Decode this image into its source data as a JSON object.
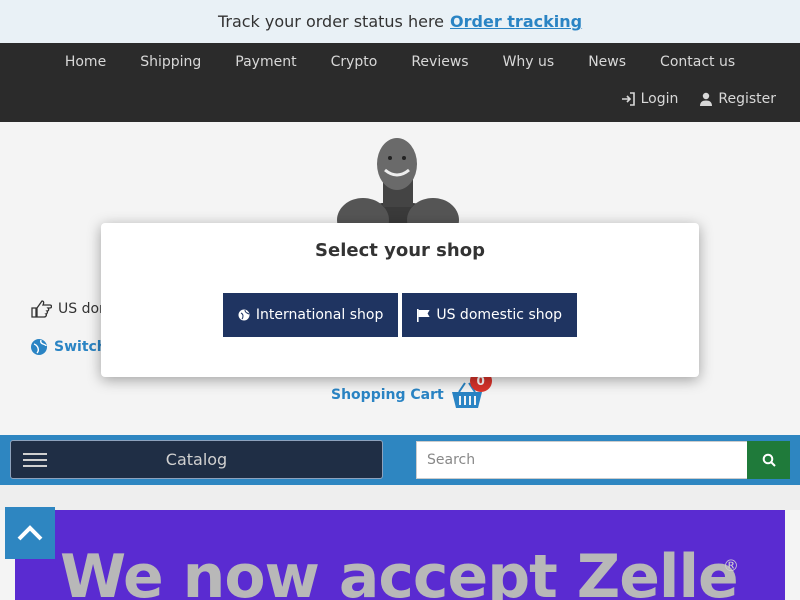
{
  "topbar": {
    "text": "Track your order status here",
    "link": "Order tracking"
  },
  "nav": {
    "items": [
      "Home",
      "Shipping",
      "Payment",
      "Crypto",
      "Reviews",
      "Why us",
      "News",
      "Contact us"
    ],
    "login": "Login",
    "register": "Register"
  },
  "main": {
    "us_domestic_label": "US dom",
    "switch_label": "Switch",
    "cart_label": "Shopping Cart",
    "cart_count": "0"
  },
  "catalog": {
    "label": "Catalog",
    "search_placeholder": "Search"
  },
  "banner": {
    "text": "We now accept Zelle",
    "mark": "®"
  },
  "modal": {
    "title": "Select your shop",
    "intl_button": "International shop",
    "us_button": "US domestic shop"
  },
  "colors": {
    "accent": "#2e86c1",
    "navy": "#1f3461",
    "nav_bg": "#2b2b2b",
    "badge": "#d9332b",
    "search_btn": "#1f7a3a",
    "banner": "#5a2bd1"
  }
}
